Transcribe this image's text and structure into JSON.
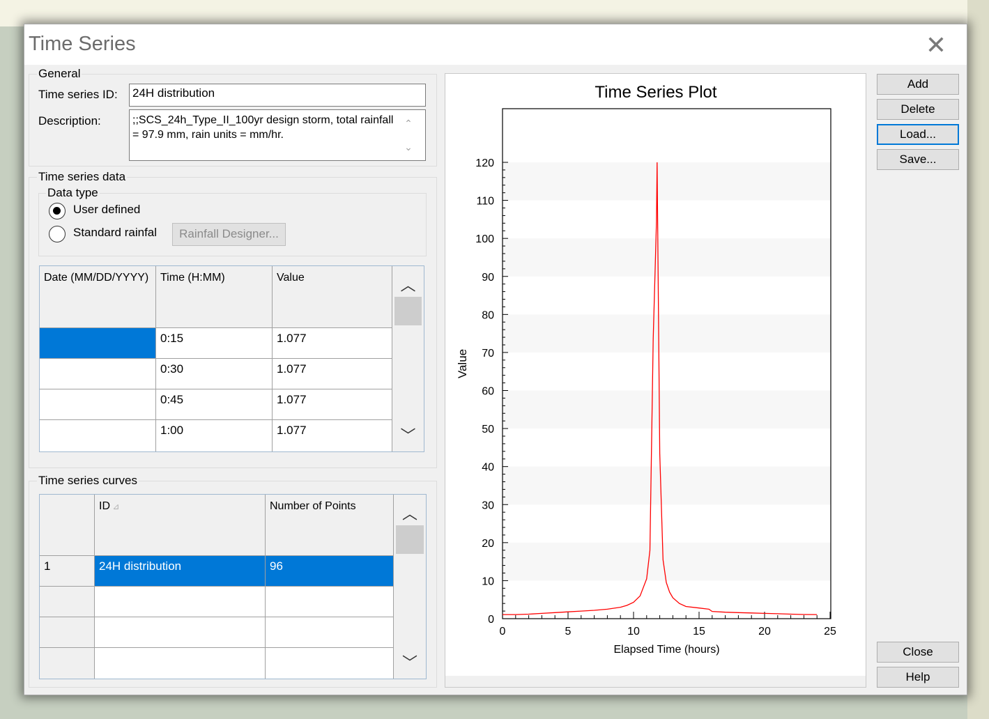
{
  "window": {
    "title": "Time Series"
  },
  "general": {
    "group_label": "General",
    "id_label": "Time series ID:",
    "id_value": "24H distribution",
    "desc_label": "Description:",
    "desc_value": ";;SCS_24h_Type_II_100yr design storm, total rainfall = 97.9 mm, rain units = mm/hr."
  },
  "ts_data": {
    "group_label": "Time series data",
    "data_type_label": "Data type",
    "options": [
      "User defined",
      "Standard rainfal"
    ],
    "selected": "User defined",
    "designer_button": "Rainfall Designer...",
    "columns": [
      "Date (MM/DD/YYYY)",
      "Time (H:MM)",
      "Value"
    ],
    "rows": [
      {
        "date": "",
        "time": "0:15",
        "value": "1.077"
      },
      {
        "date": "",
        "time": "0:30",
        "value": "1.077"
      },
      {
        "date": "",
        "time": "0:45",
        "value": "1.077"
      },
      {
        "date": "",
        "time": "1:00",
        "value": "1.077"
      }
    ]
  },
  "curves": {
    "group_label": "Time series curves",
    "columns": [
      "ID",
      "Number of Points"
    ],
    "sort_icon": "sort-asc-icon",
    "rows": [
      {
        "num": "1",
        "id": "24H distribution",
        "points": "96"
      }
    ]
  },
  "buttons": {
    "add": "Add",
    "delete": "Delete",
    "load": "Load...",
    "save": "Save...",
    "close": "Close",
    "help": "Help"
  },
  "chart_data": {
    "type": "line",
    "title": "Time Series Plot",
    "xlabel": "Elapsed Time (hours)",
    "ylabel": "Value",
    "xlim": [
      0,
      25
    ],
    "ylim": [
      0,
      120
    ],
    "xticks": [
      0,
      5,
      10,
      15,
      20,
      25
    ],
    "yticks": [
      0,
      10,
      20,
      30,
      40,
      50,
      60,
      70,
      80,
      90,
      100,
      110,
      120
    ],
    "series_color": "#ff0000",
    "grid": "horizontal bands",
    "series": [
      {
        "x": [
          0,
          0.25,
          1,
          2,
          3,
          4,
          5,
          6,
          7,
          8,
          9,
          9.5,
          10,
          10.5,
          11,
          11.25,
          11.5,
          11.75,
          11.8,
          12,
          12.25,
          12.5,
          12.75,
          13,
          13.5,
          14,
          15,
          15.75,
          16,
          17,
          18,
          19,
          20,
          21,
          22,
          23,
          24
        ],
        "y": [
          1.077,
          1.077,
          1.077,
          1.2,
          1.4,
          1.6,
          1.8,
          2.0,
          2.2,
          2.5,
          3.0,
          3.5,
          4.3,
          6.0,
          10.5,
          18.0,
          73.5,
          104.5,
          120.0,
          43.5,
          15.5,
          9.5,
          7.0,
          5.5,
          4.0,
          3.2,
          2.8,
          2.5,
          1.9,
          1.7,
          1.6,
          1.5,
          1.4,
          1.3,
          1.2,
          1.1,
          1.077
        ]
      }
    ]
  }
}
